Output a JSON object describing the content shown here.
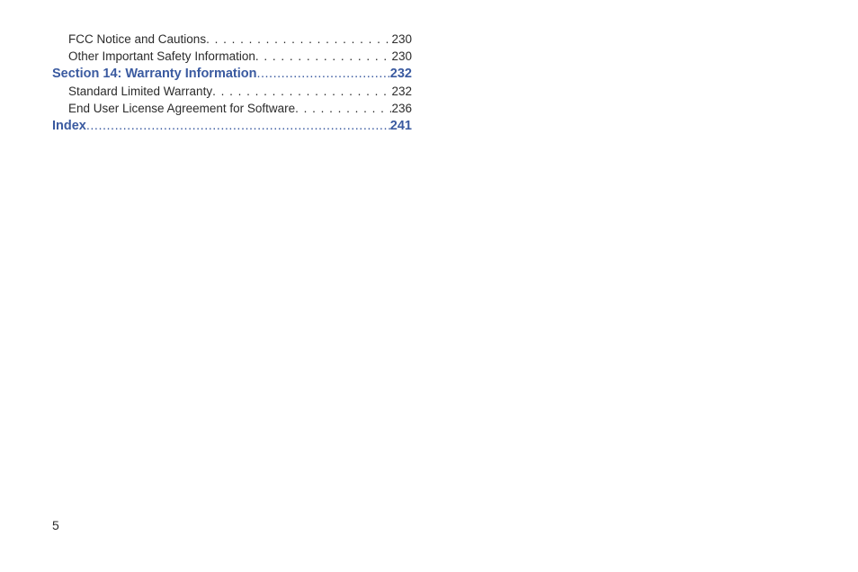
{
  "toc": [
    {
      "type": "sub",
      "label": "FCC Notice and Cautions",
      "page": "230"
    },
    {
      "type": "sub",
      "label": "Other Important Safety Information",
      "page": "230"
    },
    {
      "type": "main",
      "label": "Section 14:  Warranty Information",
      "page": "232"
    },
    {
      "type": "sub",
      "label": "Standard Limited Warranty",
      "page": "232"
    },
    {
      "type": "sub",
      "label": "End User License Agreement for Software",
      "page": "236"
    },
    {
      "type": "main",
      "label": "Index",
      "page": "241"
    }
  ],
  "leader_sub": " . . . . . . . . . . . . . . . . . . . . . . . . . . . . . . . . . . . . . . . . . . . . . . . . . . . . . . . . . . . . . . . . . . . . . . . . . . . . . . . . . .",
  "leader_main": "  .............................................................................................................................",
  "page_number": "5"
}
